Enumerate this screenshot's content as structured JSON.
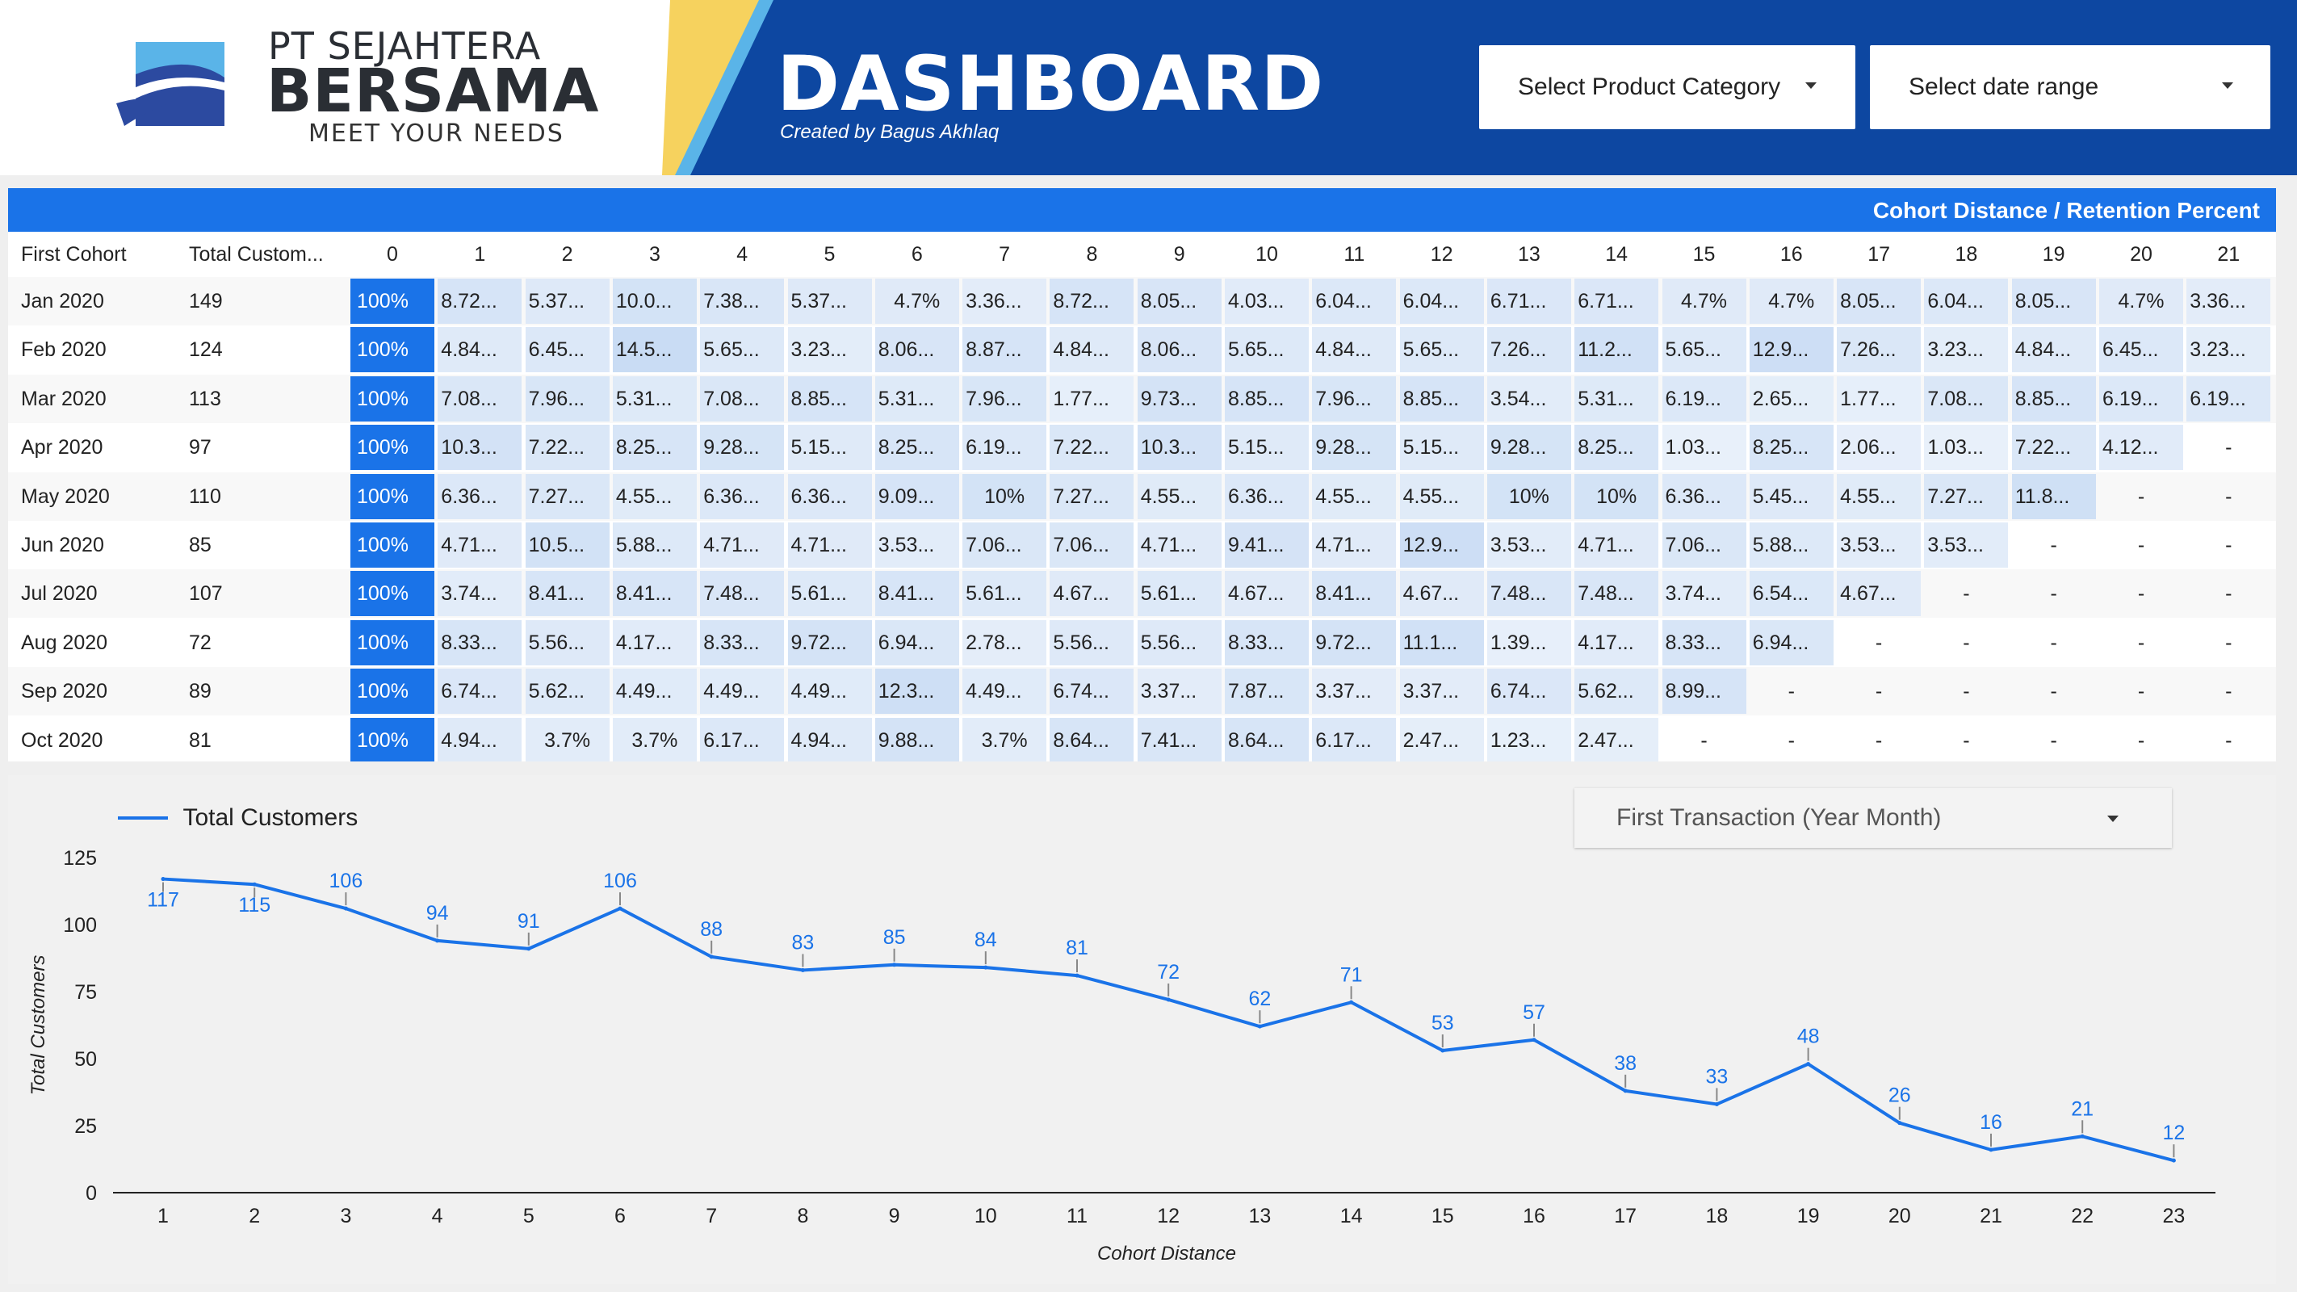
{
  "header": {
    "company_line1": "PT SEJAHTERA",
    "company_line2": "BERSAMA",
    "tagline": "MEET YOUR NEEDS",
    "title": "DASHBOARD",
    "subtitle": "Created by Bagus Akhlaq",
    "logo_icon": "wave-logo-icon",
    "colors": {
      "primary": "#0d47a1",
      "accent": "#1a73e8",
      "stripe_yellow": "#f6d25e",
      "stripe_blue": "#5ab4e8"
    }
  },
  "filters": {
    "category_label": "Select Product Category",
    "date_label": "Select date range"
  },
  "table": {
    "title": "Cohort Distance / Retention Percent",
    "col_first": "First Cohort",
    "col_total": "Total Custom...",
    "columns": [
      "0",
      "1",
      "2",
      "3",
      "4",
      "5",
      "6",
      "7",
      "8",
      "9",
      "10",
      "11",
      "12",
      "13",
      "14",
      "15",
      "16",
      "17",
      "18",
      "19",
      "20",
      "21"
    ],
    "rows": [
      {
        "cohort": "Jan 2020",
        "total": "149",
        "values": [
          "100%",
          "8.72...",
          "5.37...",
          "10.0...",
          "7.38...",
          "5.37...",
          "4.7%",
          "3.36...",
          "8.72...",
          "8.05...",
          "4.03...",
          "6.04...",
          "6.04...",
          "6.71...",
          "6.71...",
          "4.7%",
          "4.7%",
          "8.05...",
          "6.04...",
          "8.05...",
          "4.7%",
          "3.36..."
        ]
      },
      {
        "cohort": "Feb 2020",
        "total": "124",
        "values": [
          "100%",
          "4.84...",
          "6.45...",
          "14.5...",
          "5.65...",
          "3.23...",
          "8.06...",
          "8.87...",
          "4.84...",
          "8.06...",
          "5.65...",
          "4.84...",
          "5.65...",
          "7.26...",
          "11.2...",
          "5.65...",
          "12.9...",
          "7.26...",
          "3.23...",
          "4.84...",
          "6.45...",
          "3.23..."
        ]
      },
      {
        "cohort": "Mar 2020",
        "total": "113",
        "values": [
          "100%",
          "7.08...",
          "7.96...",
          "5.31...",
          "7.08...",
          "8.85...",
          "5.31...",
          "7.96...",
          "1.77...",
          "9.73...",
          "8.85...",
          "7.96...",
          "8.85...",
          "3.54...",
          "5.31...",
          "6.19...",
          "2.65...",
          "1.77...",
          "7.08...",
          "8.85...",
          "6.19...",
          "6.19..."
        ]
      },
      {
        "cohort": "Apr 2020",
        "total": "97",
        "values": [
          "100%",
          "10.3...",
          "7.22...",
          "8.25...",
          "9.28...",
          "5.15...",
          "8.25...",
          "6.19...",
          "7.22...",
          "10.3...",
          "5.15...",
          "9.28...",
          "5.15...",
          "9.28...",
          "8.25...",
          "1.03...",
          "8.25...",
          "2.06...",
          "1.03...",
          "7.22...",
          "4.12...",
          "-"
        ]
      },
      {
        "cohort": "May 2020",
        "total": "110",
        "values": [
          "100%",
          "6.36...",
          "7.27...",
          "4.55...",
          "6.36...",
          "6.36...",
          "9.09...",
          "10%",
          "7.27...",
          "4.55...",
          "6.36...",
          "4.55...",
          "4.55...",
          "10%",
          "10%",
          "6.36...",
          "5.45...",
          "4.55...",
          "7.27...",
          "11.8...",
          "-",
          "-"
        ]
      },
      {
        "cohort": "Jun 2020",
        "total": "85",
        "values": [
          "100%",
          "4.71...",
          "10.5...",
          "5.88...",
          "4.71...",
          "4.71...",
          "3.53...",
          "7.06...",
          "7.06...",
          "4.71...",
          "9.41...",
          "4.71...",
          "12.9...",
          "3.53...",
          "4.71...",
          "7.06...",
          "5.88...",
          "3.53...",
          "3.53...",
          "-",
          "-",
          "-"
        ]
      },
      {
        "cohort": "Jul 2020",
        "total": "107",
        "values": [
          "100%",
          "3.74...",
          "8.41...",
          "8.41...",
          "7.48...",
          "5.61...",
          "8.41...",
          "5.61...",
          "4.67...",
          "5.61...",
          "4.67...",
          "8.41...",
          "4.67...",
          "7.48...",
          "7.48...",
          "3.74...",
          "6.54...",
          "4.67...",
          "-",
          "-",
          "-",
          "-"
        ]
      },
      {
        "cohort": "Aug 2020",
        "total": "72",
        "values": [
          "100%",
          "8.33...",
          "5.56...",
          "4.17...",
          "8.33...",
          "9.72...",
          "6.94...",
          "2.78...",
          "5.56...",
          "5.56...",
          "8.33...",
          "9.72...",
          "11.1...",
          "1.39...",
          "4.17...",
          "8.33...",
          "6.94...",
          "-",
          "-",
          "-",
          "-",
          "-"
        ]
      },
      {
        "cohort": "Sep 2020",
        "total": "89",
        "values": [
          "100%",
          "6.74...",
          "5.62...",
          "4.49...",
          "4.49...",
          "4.49...",
          "12.3...",
          "4.49...",
          "6.74...",
          "3.37...",
          "7.87...",
          "3.37...",
          "3.37...",
          "6.74...",
          "5.62...",
          "8.99...",
          "-",
          "-",
          "-",
          "-",
          "-",
          "-"
        ]
      },
      {
        "cohort": "Oct 2020",
        "total": "81",
        "values": [
          "100%",
          "4.94...",
          "3.7%",
          "3.7%",
          "6.17...",
          "4.94...",
          "9.88...",
          "3.7%",
          "8.64...",
          "7.41...",
          "8.64...",
          "6.17...",
          "2.47...",
          "1.23...",
          "2.47...",
          "-",
          "-",
          "-",
          "-",
          "-",
          "-",
          "-"
        ]
      }
    ]
  },
  "chart_controls": {
    "dropdown_label": "First Transaction (Year Month)"
  },
  "chart_data": {
    "type": "line",
    "x": [
      1,
      2,
      3,
      4,
      5,
      6,
      7,
      8,
      9,
      10,
      11,
      12,
      13,
      14,
      15,
      16,
      17,
      18,
      19,
      20,
      21,
      22,
      23
    ],
    "series": [
      {
        "name": "Total Customers",
        "values": [
          117,
          115,
          106,
          94,
          91,
          106,
          88,
          83,
          85,
          84,
          81,
          72,
          62,
          71,
          53,
          57,
          38,
          33,
          48,
          26,
          16,
          21,
          12
        ]
      }
    ],
    "xlabel": "Cohort Distance",
    "ylabel": "Total Customers",
    "ylim": [
      0,
      125
    ],
    "yticks": [
      0,
      25,
      50,
      75,
      100,
      125
    ],
    "grid": false,
    "legend": "top-left",
    "color": "#1a73e8"
  }
}
